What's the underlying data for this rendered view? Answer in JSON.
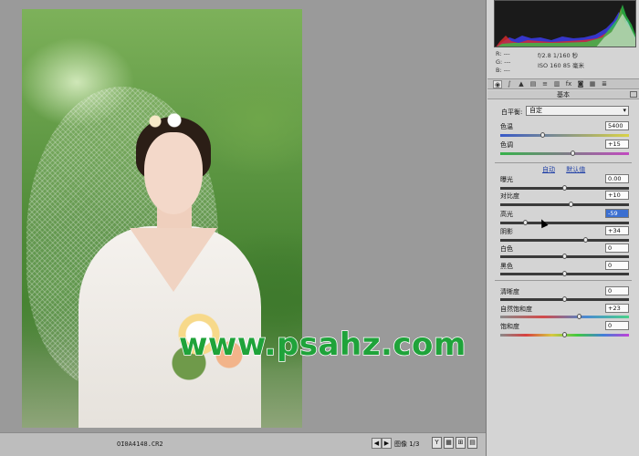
{
  "canvas": {
    "watermark": "www.psahz.com",
    "filename": "OI0A4148.CR2",
    "image_counter": "图像 1/3"
  },
  "histogram": {
    "readout": {
      "r": "R: ---",
      "g": "G: ---",
      "b": "B: ---"
    },
    "aperture_shutter": "f/2.8   1/160 秒",
    "iso_focal": "ISO 160   85 毫米"
  },
  "panel": {
    "tabs": [
      "◉",
      "∫",
      "▲",
      "▤",
      "≡",
      "▥",
      "fx",
      "◙",
      "▦",
      "≣"
    ],
    "active_tab": 0,
    "section_title": "基本",
    "white_balance": {
      "label": "白平衡:",
      "value": "自定"
    },
    "links": {
      "auto": "自动",
      "default": "默认值"
    },
    "sliders": [
      {
        "label": "色温",
        "value": "5400",
        "level": 0.33,
        "track": "temp"
      },
      {
        "label": "色调",
        "value": "+15",
        "level": 0.57,
        "track": "tint"
      },
      {
        "label": "曝光",
        "value": "0.00",
        "level": 0.5,
        "track": "plain"
      },
      {
        "label": "对比度",
        "value": "+10",
        "level": 0.55,
        "track": "plain"
      },
      {
        "label": "高光",
        "value": "-59",
        "level": 0.2,
        "track": "plain",
        "selected": true
      },
      {
        "label": "阴影",
        "value": "+34",
        "level": 0.67,
        "track": "plain"
      },
      {
        "label": "白色",
        "value": "0",
        "level": 0.5,
        "track": "plain"
      },
      {
        "label": "黑色",
        "value": "0",
        "level": 0.5,
        "track": "plain"
      },
      {
        "label": "清晰度",
        "value": "0",
        "level": 0.5,
        "track": "plain"
      },
      {
        "label": "自然饱和度",
        "value": "+23",
        "level": 0.62,
        "track": "vib"
      },
      {
        "label": "饱和度",
        "value": "0",
        "level": 0.5,
        "track": "sat"
      }
    ]
  }
}
